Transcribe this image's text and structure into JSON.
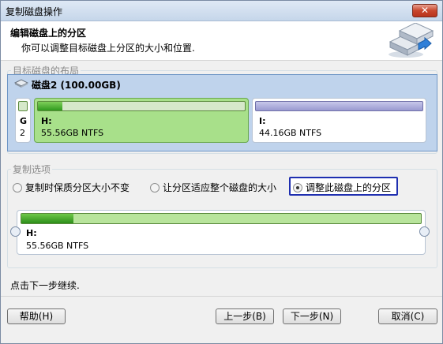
{
  "window": {
    "title": "复制磁盘操作",
    "close_label": "✕"
  },
  "header": {
    "title": "编辑磁盘上的分区",
    "subtitle": "你可以调整目标磁盘上分区的大小和位置."
  },
  "layout": {
    "legend": "目标磁盘的布局",
    "disk_label": "磁盘2 (100.00GB)",
    "partitions": [
      {
        "name": "G",
        "info": "2"
      },
      {
        "name": "H:",
        "info": "55.56GB NTFS",
        "used_fraction": 0.12
      },
      {
        "name": "I:",
        "info": "44.16GB NTFS"
      }
    ]
  },
  "copy_options": {
    "legend": "复制选项",
    "options": [
      {
        "label": "复制时保质分区大小不变",
        "checked": false
      },
      {
        "label": "让分区适应整个磁盘的大小",
        "checked": false
      },
      {
        "label": "调整此磁盘上的分区",
        "checked": true
      }
    ],
    "selected_partition": {
      "name": "H:",
      "info": "55.56GB NTFS",
      "used_fraction": 0.13
    }
  },
  "status": "点击下一步继续.",
  "buttons": {
    "help": "帮助(H)",
    "back": "上一步(B)",
    "next": "下一步(N)",
    "cancel": "取消(C)"
  },
  "colors": {
    "title_bg": "#c5d6ea",
    "disk_panel": "#bfd3ec",
    "used_green": "#2f9a1e",
    "selected_border": "#1f2fb0"
  }
}
